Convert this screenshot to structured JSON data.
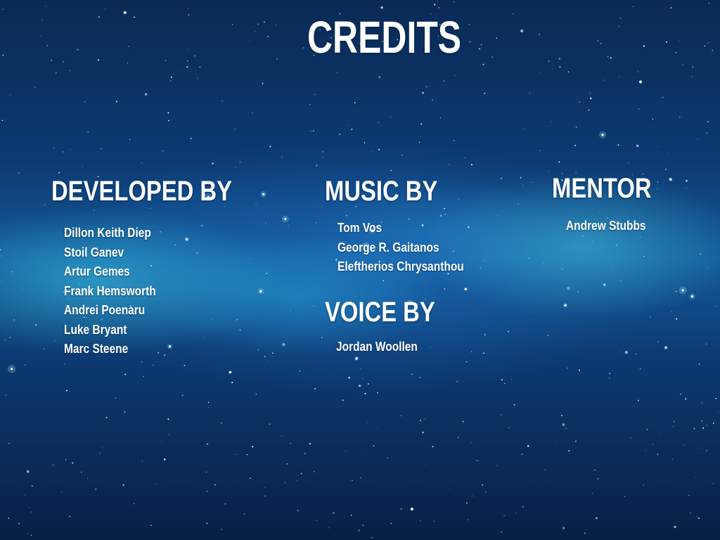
{
  "title": "CREDITS",
  "sections": {
    "developed": {
      "heading": "DEVELOPED BY",
      "names": [
        "Dillon Keith Diep",
        "Stoil Ganev",
        "Artur Gemes",
        "Frank Hemsworth",
        "Andrei Poenaru",
        "Luke Bryant",
        "Marc Steene"
      ]
    },
    "music": {
      "heading": "MUSIC BY",
      "names": [
        "Tom Vos",
        "George R. Gaitanos",
        "Eleftherios Chrysanthou"
      ]
    },
    "mentor": {
      "heading": "MENTOR",
      "names": [
        "Andrew Stubbs"
      ]
    },
    "voice": {
      "heading": "VOICE BY",
      "names": [
        "Jordan Woollen"
      ]
    }
  },
  "colors": {
    "text": "#ffffff",
    "background_deep": "#0a2a55",
    "nebula_glow": "#3cc8e6"
  }
}
